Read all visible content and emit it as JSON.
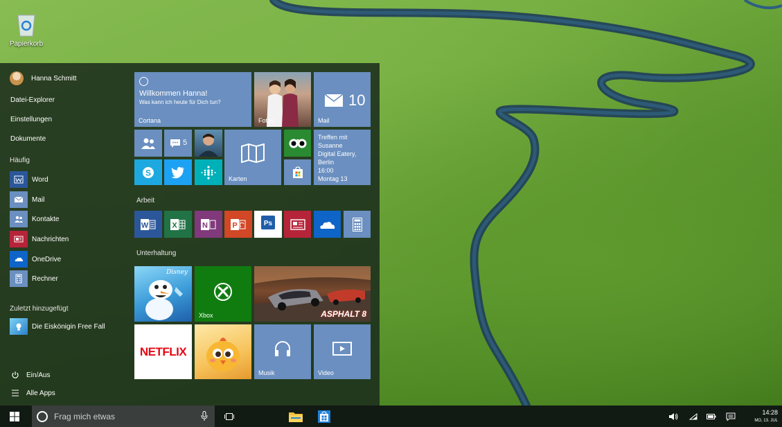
{
  "desktop": {
    "recycle_bin_label": "Papierkorb"
  },
  "start_menu": {
    "user_name": "Hanna Schmitt",
    "links": [
      "Datei-Explorer",
      "Einstellungen",
      "Dokumente"
    ],
    "frequent_title": "Häufig",
    "frequent_apps": [
      "Word",
      "Mail",
      "Kontakte",
      "Nachrichten",
      "OneDrive",
      "Rechner"
    ],
    "recent_title": "Zuletzt hinzugefügt",
    "recent_app": "Die Eiskönigin Free Fall",
    "power_label": "Ein/Aus",
    "all_apps_label": "Alle Apps"
  },
  "tiles": {
    "cortana_title": "Willkommen Hanna!",
    "cortana_subtitle": "Was kann ich heute für Dich tun?",
    "cortana_label": "Cortana",
    "photos_label": "Fotos",
    "mail_count": "10",
    "mail_label": "Mail",
    "people_badge": "5",
    "maps_label": "Karten",
    "calendar_line1": "Treffen mit",
    "calendar_line2": "Susanne",
    "calendar_line3": "Digital Eatery,",
    "calendar_line4": "Berlin",
    "calendar_time": "16:00",
    "calendar_day": "Montag 13",
    "work_group": "Arbeit",
    "entertainment_group": "Unterhaltung",
    "xbox_label": "Xbox",
    "netflix_text": "NETFLIX",
    "asphalt_text": "ASPHALT 8",
    "disney_text": "Disney",
    "music_label": "Musik",
    "video_label": "Video"
  },
  "taskbar": {
    "search_placeholder": "Frag mich etwas",
    "time": "14:28",
    "date": "MO, 13. JUL"
  },
  "colors": {
    "tile_blue": "#6a8fc0",
    "word": "#2b579a",
    "excel": "#217346",
    "onenote": "#80397b",
    "powerpoint": "#d24726",
    "news": "#b6243a",
    "onedrive": "#0f64c8",
    "xbox": "#107c10",
    "tripadvisor": "#2a8a32"
  }
}
